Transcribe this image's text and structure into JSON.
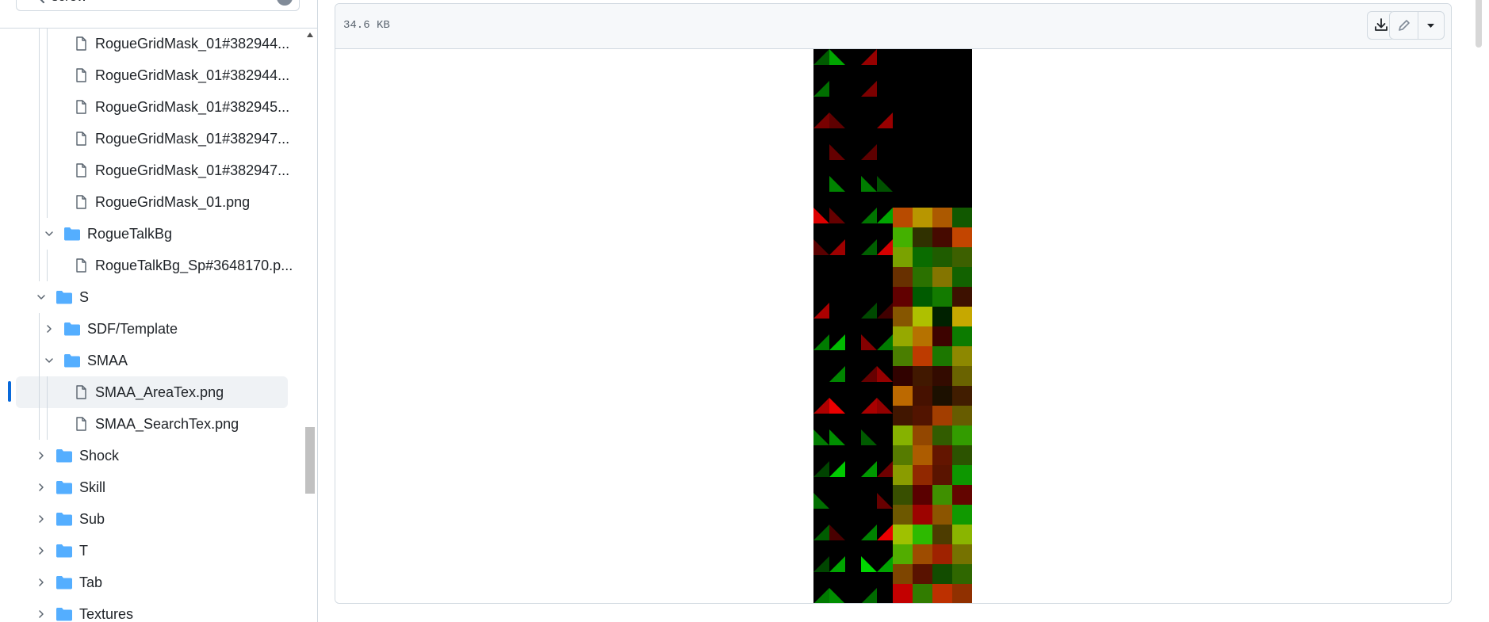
{
  "search": {
    "value": "screw"
  },
  "tree": [
    {
      "label": "RogueGridMask_01#382944...",
      "type": "file",
      "depth": 2
    },
    {
      "label": "RogueGridMask_01#382944...",
      "type": "file",
      "depth": 2
    },
    {
      "label": "RogueGridMask_01#382945...",
      "type": "file",
      "depth": 2
    },
    {
      "label": "RogueGridMask_01#382947...",
      "type": "file",
      "depth": 2
    },
    {
      "label": "RogueGridMask_01#382947...",
      "type": "file",
      "depth": 2
    },
    {
      "label": "RogueGridMask_01.png",
      "type": "file",
      "depth": 2
    },
    {
      "label": "RogueTalkBg",
      "type": "folder",
      "expanded": true,
      "depth": 1
    },
    {
      "label": "RogueTalkBg_Sp#3648170.p...",
      "type": "file",
      "depth": 2
    },
    {
      "label": "S",
      "type": "folder",
      "expanded": true,
      "depth": 0
    },
    {
      "label": "SDF/Template",
      "type": "folder",
      "expanded": false,
      "depth": 1
    },
    {
      "label": "SMAA",
      "type": "folder",
      "expanded": true,
      "depth": 1
    },
    {
      "label": "SMAA_AreaTex.png",
      "type": "file",
      "depth": 2,
      "selected": true
    },
    {
      "label": "SMAA_SearchTex.png",
      "type": "file",
      "depth": 2
    },
    {
      "label": "Shock",
      "type": "folder",
      "expanded": false,
      "depth": 0
    },
    {
      "label": "Skill",
      "type": "folder",
      "expanded": false,
      "depth": 0
    },
    {
      "label": "Sub",
      "type": "folder",
      "expanded": false,
      "depth": 0
    },
    {
      "label": "T",
      "type": "folder",
      "expanded": false,
      "depth": 0
    },
    {
      "label": "Tab",
      "type": "folder",
      "expanded": false,
      "depth": 0
    },
    {
      "label": "Textures",
      "type": "folder",
      "expanded": false,
      "depth": 0
    }
  ],
  "file_header": {
    "size": "34.6 KB"
  },
  "icons": {
    "search": "search-icon",
    "clear": "clear-icon",
    "download": "download-icon",
    "edit": "pencil-icon",
    "more": "triangle-down-icon",
    "file": "file-icon",
    "folder": "folder-icon",
    "chevron_down": "chevron-down-icon",
    "chevron_right": "chevron-right-icon"
  },
  "colors": {
    "accent": "#0969da",
    "folder": "#54aeff",
    "selected_bg": "#eff2f5",
    "border": "#d1d9e0",
    "header_bg": "#f6f8fa"
  }
}
